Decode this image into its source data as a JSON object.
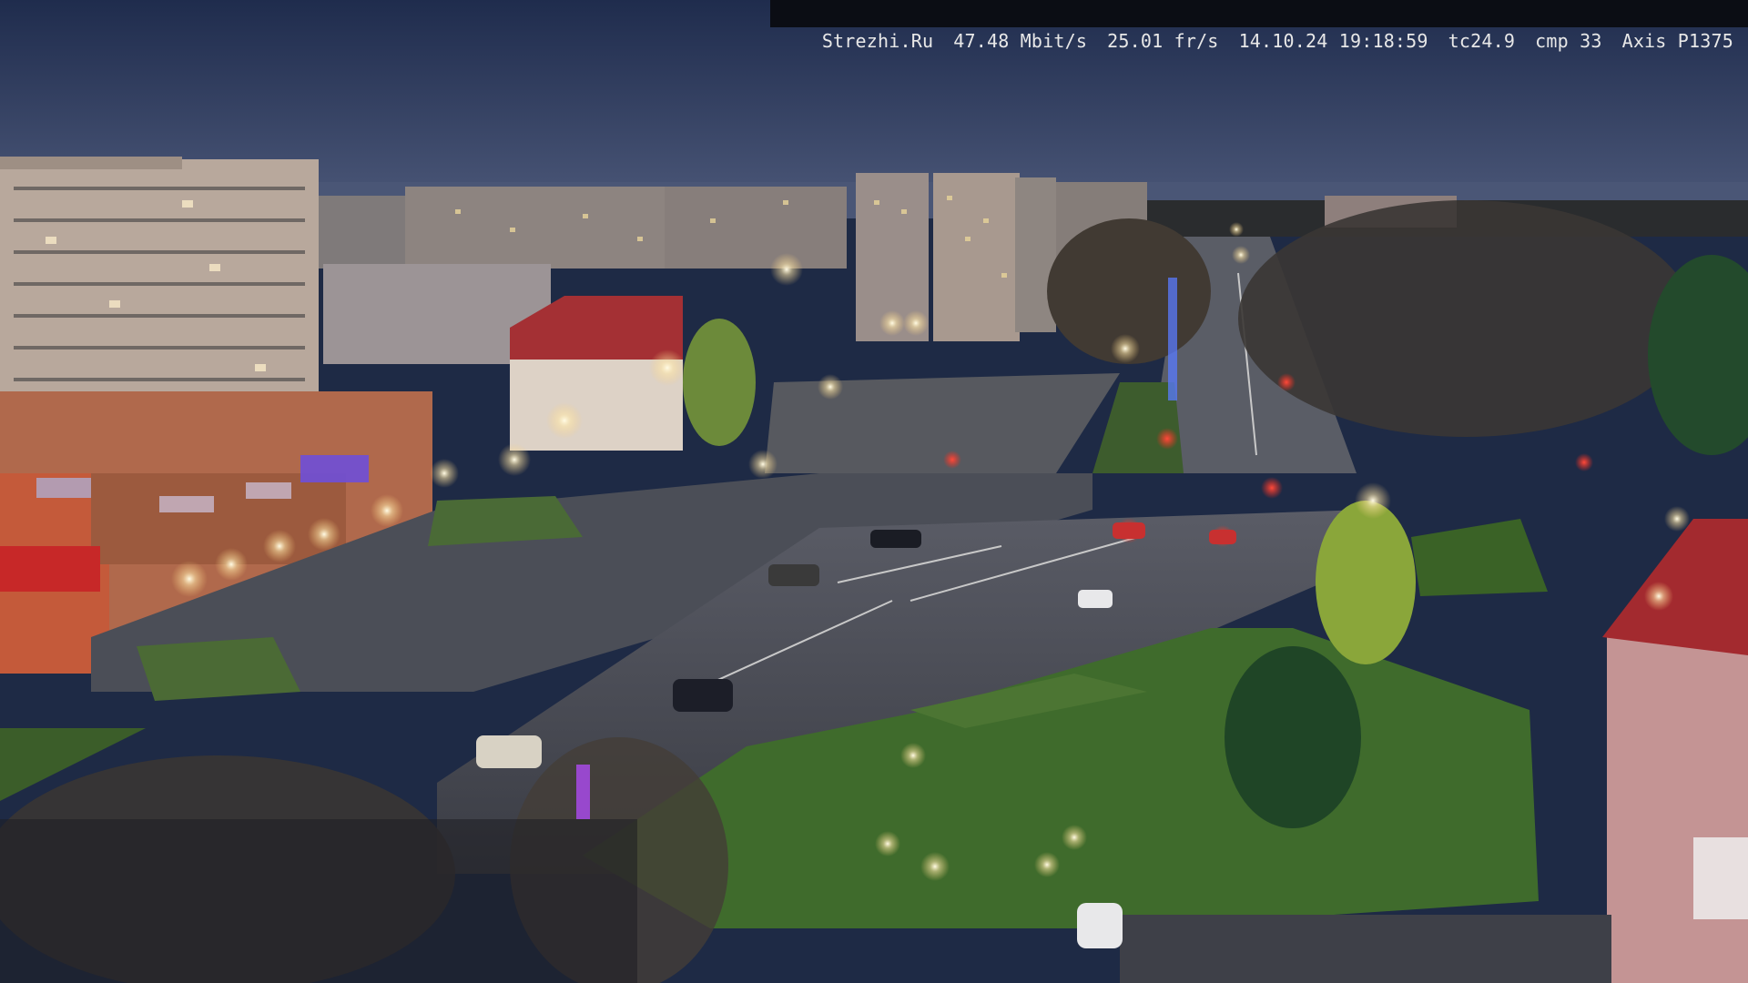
{
  "overlay": {
    "site": "Strezhi.Ru",
    "bitrate": "47.48 Mbit/s",
    "framerate": "25.01 fr/s",
    "datetime": "14.10.24 19:18:59",
    "tc": "tc24.9",
    "cmp": "cmp 33",
    "camera": "Axis P1375"
  },
  "scene": {
    "sky_color": "#2a3a5e",
    "horizon_color": "#4a5676",
    "asphalt_color": "#3c3f48",
    "grass_color": "#3f6b2c",
    "building_color": "#b7a79a"
  }
}
